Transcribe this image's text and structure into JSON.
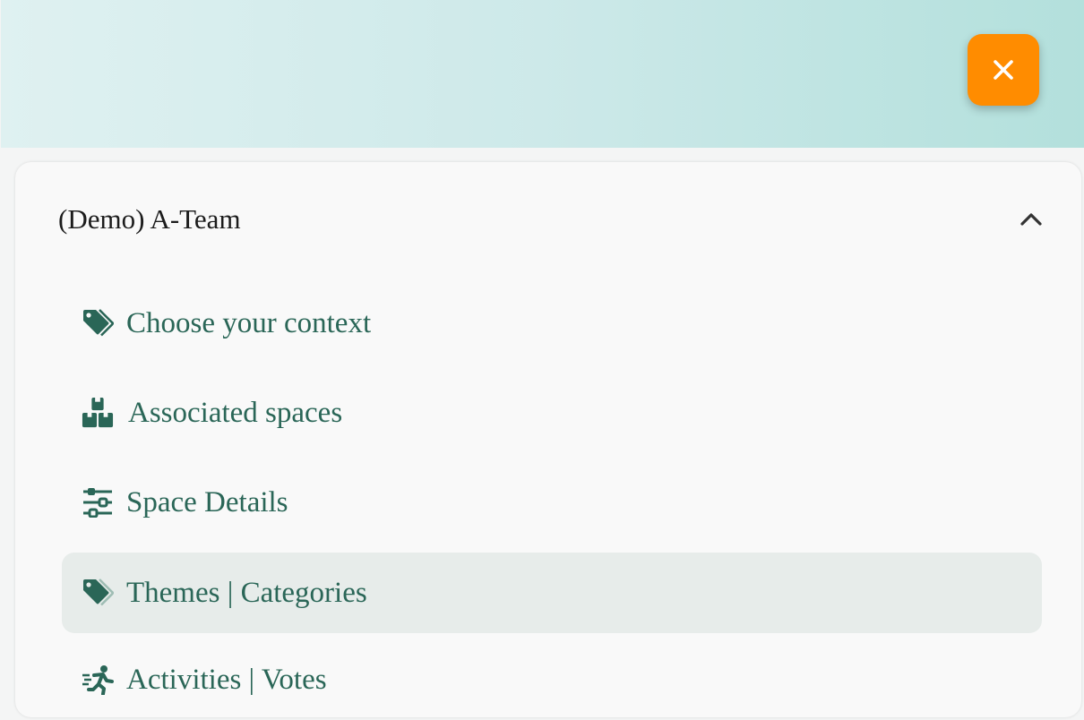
{
  "header": {
    "close_icon": "close-icon",
    "accent_color": "#ff8c00"
  },
  "space": {
    "title": "(Demo) A-Team",
    "expanded": true
  },
  "menu": {
    "items": [
      {
        "label": "Choose your context",
        "icon": "tags-icon",
        "active": false
      },
      {
        "label": "Associated spaces",
        "icon": "boxes-icon",
        "active": false
      },
      {
        "label": "Space Details",
        "icon": "sliders-icon",
        "active": false
      },
      {
        "label": "Themes | Categories",
        "icon": "tags-icon",
        "active": true
      },
      {
        "label": "Activities | Votes",
        "icon": "running-person-icon",
        "active": false
      }
    ]
  },
  "colors": {
    "menu_text": "#2a6657",
    "active_background": "#e7ecea"
  }
}
